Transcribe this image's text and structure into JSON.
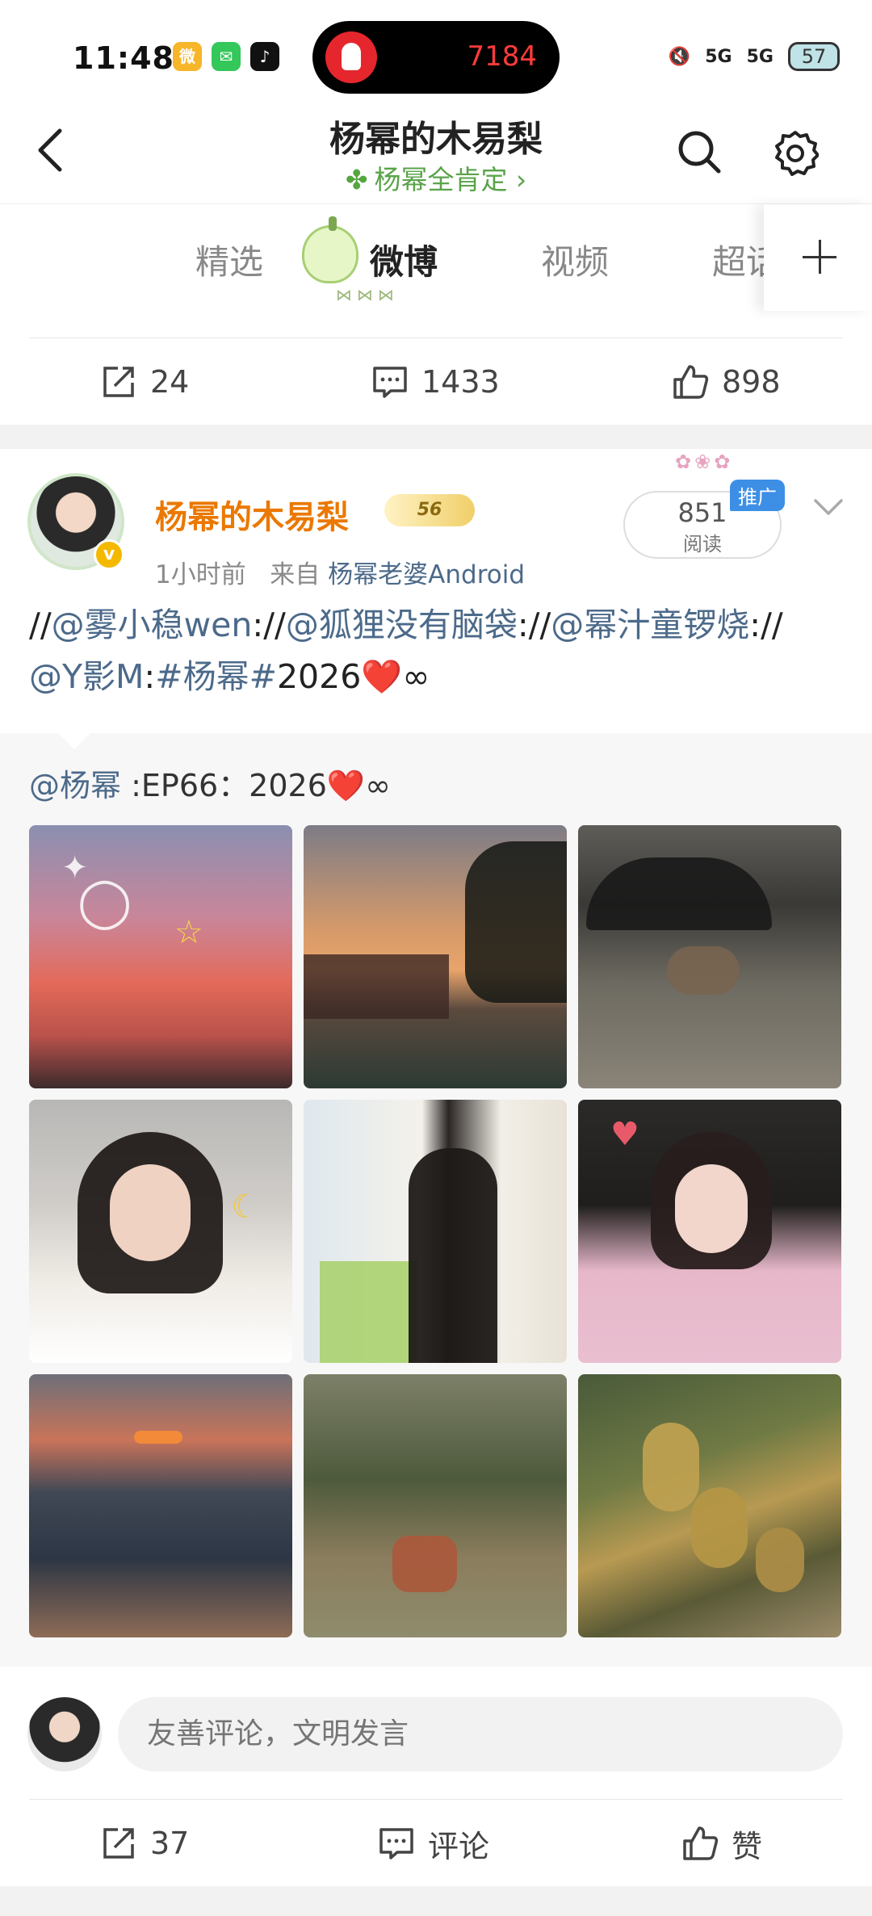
{
  "status_bar": {
    "time": "11:48",
    "island_number": "7184",
    "network": "5G",
    "network2": "5G",
    "battery": "57"
  },
  "header": {
    "title": "杨幂的木易梨",
    "subtitle": "杨幂全肯定",
    "subtitle_arrow": "›"
  },
  "tabs": [
    {
      "label": "精选"
    },
    {
      "label": "微博"
    },
    {
      "label": "视频"
    },
    {
      "label": "超话"
    }
  ],
  "top_actions": {
    "reposts": "24",
    "comments": "1433",
    "likes": "898"
  },
  "post": {
    "author": "杨幂的木易梨",
    "level": "56",
    "time": "1小时前",
    "source_prefix": "来自",
    "source": "杨幂老婆Android",
    "read_count": "851",
    "read_label": "阅读",
    "promo_label": "推广",
    "text_parts": {
      "p0": "//",
      "m1": "@雾小稳wen",
      "p1": "://",
      "m2": "@狐狸没有脑袋",
      "p2": "://",
      "m3": "@幂汁童锣烧",
      "p3": "://",
      "m4": "@Y影M",
      "p4": ":",
      "tag": "#杨幂#",
      "tail": "2026",
      "heart": "❤️",
      "inf": "∞"
    },
    "repost": {
      "mention": "@杨幂",
      "text": " :EP66：2026",
      "heart": "❤️",
      "inf": "∞"
    }
  },
  "comment_bar": {
    "placeholder": "友善评论，文明发言"
  },
  "bottom_actions": {
    "reposts": "37",
    "comment_label": "评论",
    "like_label": "赞"
  },
  "colors": {
    "accent_orange": "#eb7800",
    "link_blue": "#4c6a8a",
    "green": "#5aa34a",
    "promo_blue": "#3d8fe6"
  }
}
